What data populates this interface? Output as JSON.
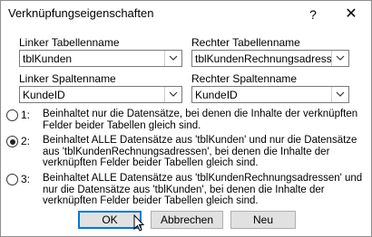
{
  "window": {
    "title": "Verknüpfungseigenschaften",
    "help_glyph": "?",
    "close_glyph": "✕"
  },
  "left": {
    "table_label": "Linker Tabellenname",
    "table_value": "tblKunden",
    "column_label": "Linker Spaltenname",
    "column_value": "KundeID"
  },
  "right": {
    "table_label": "Rechter Tabellenname",
    "table_value": "tblKundenRechnungsadressen",
    "column_label": "Rechter Spaltenname",
    "column_value": "KundeID"
  },
  "options": [
    {
      "number": "1:",
      "lines": [
        "Beinhaltet nur die Datensätze, bei denen die Inhalte der verknüpften",
        "Felder beider Tabellen gleich sind."
      ],
      "selected": false
    },
    {
      "number": "2:",
      "lines": [
        "Beinhaltet ALLE Datensätze aus 'tblKunden' und nur die Datensätze",
        "aus 'tblKundenRechnungsadressen', bei denen die Inhalte der",
        "verknüpften Felder beider Tabellen gleich sind."
      ],
      "selected": true
    },
    {
      "number": "3:",
      "lines": [
        "Beinhaltet ALLE Datensätze aus 'tblKundenRechnungsadressen' und",
        "nur die Datensätze aus 'tblKunden', bei denen die Inhalte der",
        "verknüpften Felder beider Tabellen gleich sind."
      ],
      "selected": false
    }
  ],
  "buttons": {
    "ok": "OK",
    "cancel": "Abbrechen",
    "new": "Neu"
  }
}
